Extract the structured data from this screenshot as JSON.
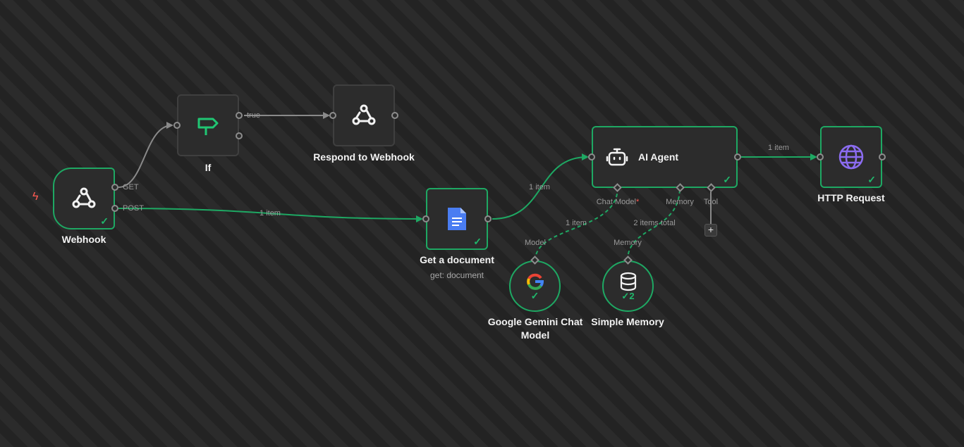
{
  "canvas": {
    "nodes": {
      "webhook": {
        "name": "Webhook",
        "icon": "webhook-icon",
        "outputs": [
          "GET",
          "POST"
        ],
        "status": "success"
      },
      "if": {
        "name": "If",
        "icon": "signpost-icon",
        "outputs": [
          "true"
        ]
      },
      "respond": {
        "name": "Respond to Webhook",
        "icon": "webhook-icon"
      },
      "get_document": {
        "name": "Get a document",
        "subtitle": "get: document",
        "icon": "google-docs-icon",
        "status": "success"
      },
      "ai_agent": {
        "name": "AI Agent",
        "icon": "robot-icon",
        "status": "success",
        "sub_ports": {
          "chat_model": "Chat Model",
          "chat_model_required": "*",
          "memory": "Memory",
          "tool": "Tool"
        }
      },
      "http_request": {
        "name": "HTTP Request",
        "icon": "globe-icon",
        "status": "success"
      },
      "gemini": {
        "name": "Google Gemini Chat Model",
        "port_label": "Model",
        "icon": "google-icon",
        "status": "success"
      },
      "memory": {
        "name": "Simple Memory",
        "port_label": "Memory",
        "icon": "database-icon",
        "status": "success",
        "run_count": "2"
      }
    },
    "edges": {
      "webhook_if": {
        "label": ""
      },
      "if_respond": {
        "label": ""
      },
      "webhook_getdoc": {
        "label": "1 item"
      },
      "getdoc_agent": {
        "label": "1 item"
      },
      "agent_http": {
        "label": "1 item"
      },
      "gemini_agent": {
        "label": "1 item"
      },
      "memory_agent": {
        "label": "2 items total"
      }
    },
    "glyphs": {
      "check": "✓",
      "plus": "+",
      "bolt": "ϟ"
    },
    "colors": {
      "success": "#1ea863",
      "accent_red": "#ff5a52",
      "globe": "#8b6cf0",
      "docs": "#4a7df2"
    }
  }
}
